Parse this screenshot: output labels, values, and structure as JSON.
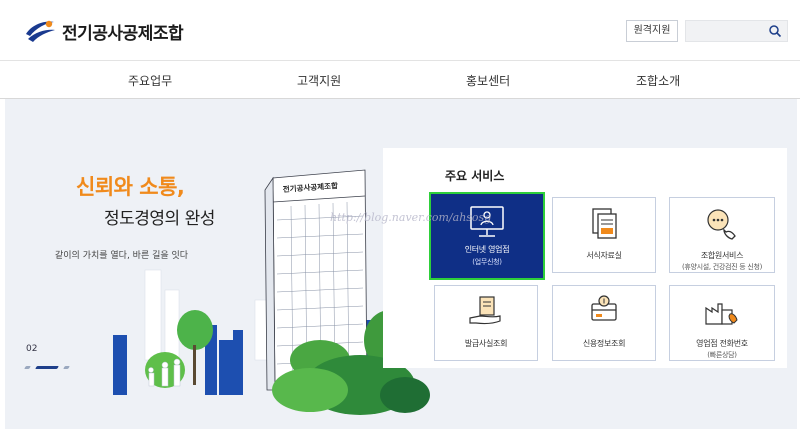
{
  "header": {
    "logo_text": "전기공사공제조합",
    "remote_support": "원격지원",
    "search_placeholder": ""
  },
  "nav": {
    "items": [
      {
        "label": "주요업무"
      },
      {
        "label": "고객지원"
      },
      {
        "label": "홍보센터"
      },
      {
        "label": "조합소개"
      }
    ]
  },
  "hero": {
    "slogan_line1": "신뢰와 소통,",
    "slogan_line2": "정도경영의 완성",
    "slogan_line3": "같이의 가치를 열다, 바른 길을 잇다",
    "slide_number": "02",
    "building_sign": "전기공사공제조합"
  },
  "services": {
    "title": "주요 서비스",
    "cards": [
      {
        "icon": "monitor-person-icon",
        "label": "인터넷 영업점",
        "sub": "(업무신청)",
        "selected": true
      },
      {
        "icon": "documents-icon",
        "label": "서식자료실",
        "sub": ""
      },
      {
        "icon": "chat-phone-icon",
        "label": "조합원서비스",
        "sub": "(휴양시설, 건강검진 등 신청)"
      },
      {
        "icon": "hand-certificate-icon",
        "label": "발급사실조회",
        "sub": ""
      },
      {
        "icon": "credit-card-icon",
        "label": "신용정보조회",
        "sub": ""
      },
      {
        "icon": "factory-phone-icon",
        "label": "영업점 전화번호",
        "sub": "(빠른상담)"
      }
    ]
  },
  "watermark": "http://blog.naver.com/ahsosg",
  "colors": {
    "accent_orange": "#f08a1c",
    "brand_navy": "#0f2f86",
    "selection_green": "#2ecf3a",
    "hero_bg": "#eef1f6"
  }
}
